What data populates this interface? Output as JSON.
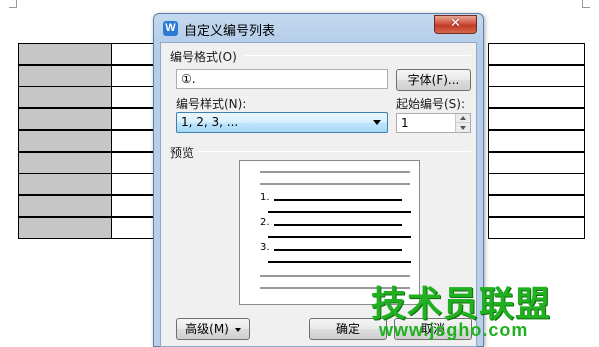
{
  "dialog": {
    "icon_glyph": "W",
    "title": "自定义编号列表",
    "close_glyph": "✕",
    "number_format_label": "编号格式(O)",
    "number_format_value": "①.",
    "font_button": "字体(F)...",
    "number_style_label": "编号样式(N):",
    "number_style_value": "1, 2, 3, ...",
    "start_at_label": "起始编号(S):",
    "start_at_value": "1",
    "preview_label": "预览",
    "preview_numbers": [
      "1.",
      "2.",
      "3."
    ],
    "advanced_button": "高级(M)",
    "ok_button": "确定",
    "cancel_button": "取消"
  },
  "watermark": {
    "main": "技术员联盟",
    "url": "www.jsgho.com"
  },
  "colors": {
    "title_bar": "#c4d9ef",
    "close_button": "#c03a26",
    "table_shade": "#c6c6c6",
    "watermark": "#20b020"
  },
  "icons": [
    "wps-writer-icon",
    "close-icon",
    "dropdown-arrow-icon",
    "spin-up-icon",
    "spin-down-icon",
    "advanced-expand-icon"
  ]
}
